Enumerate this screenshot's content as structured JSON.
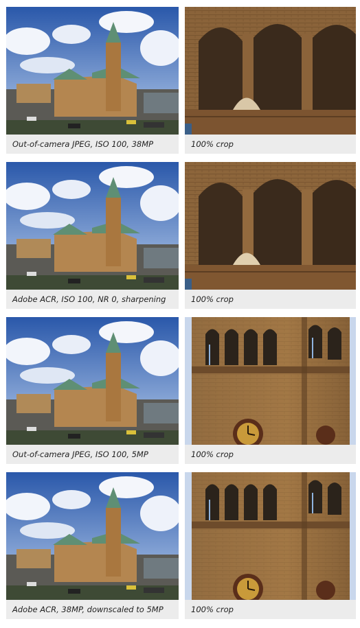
{
  "rows": [
    {
      "left_caption": "Out-of-camera JPEG, ISO 100, 38MP",
      "right_caption": "100% crop",
      "left_scene": "church-photo",
      "right_scene": "arches-crop"
    },
    {
      "left_caption": "Adobe ACR, ISO 100, NR 0, sharpening",
      "right_caption": "100% crop",
      "left_scene": "church-photo",
      "right_scene": "arches-crop"
    },
    {
      "left_caption": "Out-of-camera JPEG, ISO 100, 5MP",
      "right_caption": "100% crop",
      "left_scene": "church-photo",
      "right_scene": "tower-crop"
    },
    {
      "left_caption": "Adobe ACR, 38MP, downscaled to 5MP",
      "right_caption": "100% crop",
      "left_scene": "church-photo",
      "right_scene": "tower-crop"
    }
  ],
  "colors": {
    "sky_top": "#2f5fb0",
    "sky_bottom": "#a9c2e6",
    "brick": "#a9773f",
    "roof": "#5f8f74",
    "caption_bg": "#ececec"
  }
}
